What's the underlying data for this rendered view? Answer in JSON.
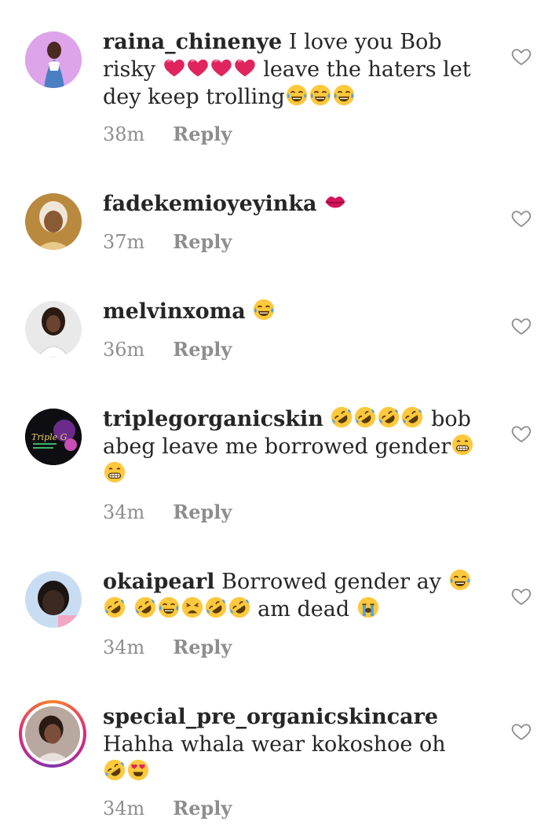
{
  "comments": [
    {
      "username": "raina_chinenye",
      "text_1": " I love you Bob risky",
      "text_2": " leave the haters let dey keep trolling",
      "time": "38m",
      "reply": "Reply"
    },
    {
      "username": "fadekemioyeyinka",
      "time": "37m",
      "reply": "Reply"
    },
    {
      "username": "melvinxoma",
      "time": "36m",
      "reply": "Reply"
    },
    {
      "username": "triplegorganicskin",
      "text": " bob abeg leave me  borrowed gender",
      "avatar_text": "Triple G",
      "time": "34m",
      "reply": "Reply"
    },
    {
      "username": "okaipearl",
      "text_1": " Borrowed gender ay ",
      "text_2": " am dead ",
      "time": "34m",
      "reply": "Reply"
    },
    {
      "username": "special_pre_organicskincare",
      "text": " Hahha whala wear kokoshoe oh",
      "time": "34m",
      "reply": "Reply"
    }
  ],
  "icons": {
    "heart_outline": "heart-outline-icon",
    "emoji_colors": {
      "face": "#ffc83d",
      "tear": "#4aa3f0",
      "red_heart": "#e0245e",
      "lips": "#d4145a"
    }
  }
}
